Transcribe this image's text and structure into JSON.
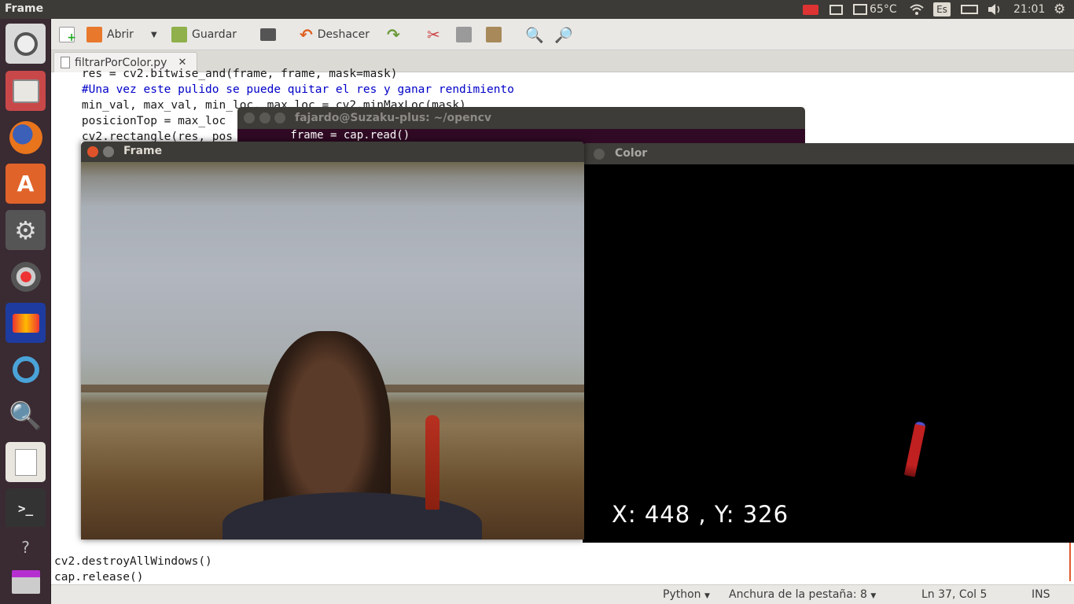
{
  "top_panel": {
    "app_title": "Frame",
    "temperature": "65°C",
    "keyboard_layout": "Es",
    "clock": "21:01"
  },
  "toolbar": {
    "open_label": "Abrir",
    "save_label": "Guardar",
    "undo_label": "Deshacer"
  },
  "tab": {
    "filename": "filtrarPorColor.py",
    "close": "✕"
  },
  "editor": {
    "lines_top": [
      "    res = cv2.bitwise_and(frame, frame, mask=mask)",
      "    #Una vez este pulido se puede quitar el res y ganar rendimiento",
      "    min_val, max_val, min_loc, max_loc = cv2.minMaxLoc(mask)",
      "    posicionTop = max_loc",
      "    cv2.rectangle(res, pos"
    ],
    "lines_bottom": [
      "cv2.destroyAllWindows()",
      "cap.release()"
    ]
  },
  "terminal": {
    "title": "fajardo@Suzaku-plus: ~/opencv",
    "line": "        frame = cap.read()"
  },
  "frame_window": {
    "title": "Frame"
  },
  "color_window": {
    "title": "Color",
    "coord_text": "X: 448 , Y: 326"
  },
  "statusbar": {
    "language": "Python",
    "tab_width": "Anchura de la pestaña: 8",
    "cursor_pos": "Ln 37, Col 5",
    "mode": "INS"
  }
}
